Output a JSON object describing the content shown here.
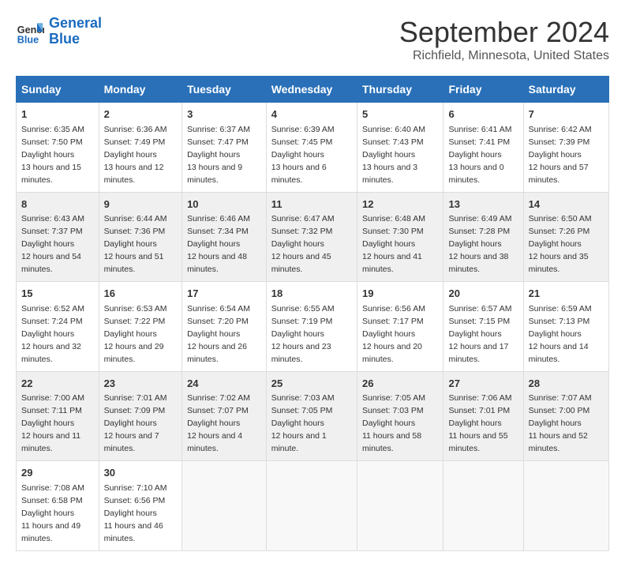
{
  "header": {
    "logo_line1": "General",
    "logo_line2": "Blue",
    "main_title": "September 2024",
    "subtitle": "Richfield, Minnesota, United States"
  },
  "days_of_week": [
    "Sunday",
    "Monday",
    "Tuesday",
    "Wednesday",
    "Thursday",
    "Friday",
    "Saturday"
  ],
  "weeks": [
    [
      {
        "day": "1",
        "sunrise": "6:35 AM",
        "sunset": "7:50 PM",
        "daylight": "13 hours and 15 minutes."
      },
      {
        "day": "2",
        "sunrise": "6:36 AM",
        "sunset": "7:49 PM",
        "daylight": "13 hours and 12 minutes."
      },
      {
        "day": "3",
        "sunrise": "6:37 AM",
        "sunset": "7:47 PM",
        "daylight": "13 hours and 9 minutes."
      },
      {
        "day": "4",
        "sunrise": "6:39 AM",
        "sunset": "7:45 PM",
        "daylight": "13 hours and 6 minutes."
      },
      {
        "day": "5",
        "sunrise": "6:40 AM",
        "sunset": "7:43 PM",
        "daylight": "13 hours and 3 minutes."
      },
      {
        "day": "6",
        "sunrise": "6:41 AM",
        "sunset": "7:41 PM",
        "daylight": "13 hours and 0 minutes."
      },
      {
        "day": "7",
        "sunrise": "6:42 AM",
        "sunset": "7:39 PM",
        "daylight": "12 hours and 57 minutes."
      }
    ],
    [
      {
        "day": "8",
        "sunrise": "6:43 AM",
        "sunset": "7:37 PM",
        "daylight": "12 hours and 54 minutes."
      },
      {
        "day": "9",
        "sunrise": "6:44 AM",
        "sunset": "7:36 PM",
        "daylight": "12 hours and 51 minutes."
      },
      {
        "day": "10",
        "sunrise": "6:46 AM",
        "sunset": "7:34 PM",
        "daylight": "12 hours and 48 minutes."
      },
      {
        "day": "11",
        "sunrise": "6:47 AM",
        "sunset": "7:32 PM",
        "daylight": "12 hours and 45 minutes."
      },
      {
        "day": "12",
        "sunrise": "6:48 AM",
        "sunset": "7:30 PM",
        "daylight": "12 hours and 41 minutes."
      },
      {
        "day": "13",
        "sunrise": "6:49 AM",
        "sunset": "7:28 PM",
        "daylight": "12 hours and 38 minutes."
      },
      {
        "day": "14",
        "sunrise": "6:50 AM",
        "sunset": "7:26 PM",
        "daylight": "12 hours and 35 minutes."
      }
    ],
    [
      {
        "day": "15",
        "sunrise": "6:52 AM",
        "sunset": "7:24 PM",
        "daylight": "12 hours and 32 minutes."
      },
      {
        "day": "16",
        "sunrise": "6:53 AM",
        "sunset": "7:22 PM",
        "daylight": "12 hours and 29 minutes."
      },
      {
        "day": "17",
        "sunrise": "6:54 AM",
        "sunset": "7:20 PM",
        "daylight": "12 hours and 26 minutes."
      },
      {
        "day": "18",
        "sunrise": "6:55 AM",
        "sunset": "7:19 PM",
        "daylight": "12 hours and 23 minutes."
      },
      {
        "day": "19",
        "sunrise": "6:56 AM",
        "sunset": "7:17 PM",
        "daylight": "12 hours and 20 minutes."
      },
      {
        "day": "20",
        "sunrise": "6:57 AM",
        "sunset": "7:15 PM",
        "daylight": "12 hours and 17 minutes."
      },
      {
        "day": "21",
        "sunrise": "6:59 AM",
        "sunset": "7:13 PM",
        "daylight": "12 hours and 14 minutes."
      }
    ],
    [
      {
        "day": "22",
        "sunrise": "7:00 AM",
        "sunset": "7:11 PM",
        "daylight": "12 hours and 11 minutes."
      },
      {
        "day": "23",
        "sunrise": "7:01 AM",
        "sunset": "7:09 PM",
        "daylight": "12 hours and 7 minutes."
      },
      {
        "day": "24",
        "sunrise": "7:02 AM",
        "sunset": "7:07 PM",
        "daylight": "12 hours and 4 minutes."
      },
      {
        "day": "25",
        "sunrise": "7:03 AM",
        "sunset": "7:05 PM",
        "daylight": "12 hours and 1 minute."
      },
      {
        "day": "26",
        "sunrise": "7:05 AM",
        "sunset": "7:03 PM",
        "daylight": "11 hours and 58 minutes."
      },
      {
        "day": "27",
        "sunrise": "7:06 AM",
        "sunset": "7:01 PM",
        "daylight": "11 hours and 55 minutes."
      },
      {
        "day": "28",
        "sunrise": "7:07 AM",
        "sunset": "7:00 PM",
        "daylight": "11 hours and 52 minutes."
      }
    ],
    [
      {
        "day": "29",
        "sunrise": "7:08 AM",
        "sunset": "6:58 PM",
        "daylight": "11 hours and 49 minutes."
      },
      {
        "day": "30",
        "sunrise": "7:10 AM",
        "sunset": "6:56 PM",
        "daylight": "11 hours and 46 minutes."
      },
      null,
      null,
      null,
      null,
      null
    ]
  ]
}
